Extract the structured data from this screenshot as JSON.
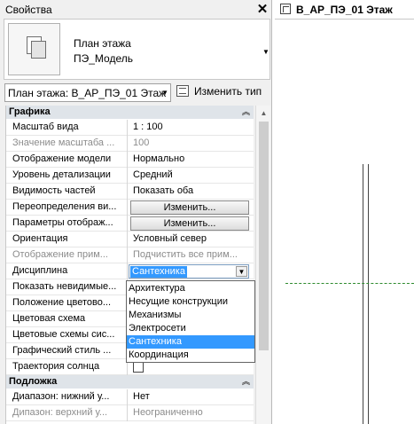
{
  "properties": {
    "title": "Свойства",
    "close_icon": "close-icon",
    "type": {
      "line1": "План этажа",
      "line2": "ПЭ_Модель"
    },
    "view_selector": "План этажа: В_АР_ПЭ_01 Этаж",
    "edit_type": "Изменить тип",
    "sections": {
      "graphics": "Графика",
      "underlay": "Подложка"
    },
    "rows": [
      {
        "name": "Масштаб вида",
        "value": "1 : 100"
      },
      {
        "name": "Значение масштаба ...",
        "value": "100"
      },
      {
        "name": "Отображение модели",
        "value": "Нормально"
      },
      {
        "name": "Уровень детализации",
        "value": "Средний"
      },
      {
        "name": "Видимость частей",
        "value": "Показать оба"
      },
      {
        "name": "Переопределения ви...",
        "value": "Изменить..."
      },
      {
        "name": "Параметры отображ...",
        "value": "Изменить..."
      },
      {
        "name": "Ориентация",
        "value": "Условный север"
      },
      {
        "name": "Отображение прим...",
        "value": "Подчистить все прим..."
      },
      {
        "name": "Дисциплина",
        "value": "Сантехника"
      },
      {
        "name": "Показать невидимые..."
      },
      {
        "name": "Положение цветово..."
      },
      {
        "name": "Цветовая схема"
      },
      {
        "name": "Цветовые схемы сис..."
      },
      {
        "name": "Графический стиль ..."
      },
      {
        "name": "Траектория солнца"
      }
    ],
    "underlay_rows": [
      {
        "name": "Диапазон: нижний у...",
        "value": "Нет"
      },
      {
        "name": "Дипазон: верхний у...",
        "value": "Неограниченно"
      }
    ],
    "discipline_options": [
      "Архитектура",
      "Несущие конструкции",
      "Механизмы",
      "Электросети",
      "Сантехника",
      "Координация"
    ],
    "discipline_selected": "Сантехника"
  },
  "view_tab": {
    "title": "В_АР_ПЭ_01 Этаж",
    "close_icon": "close-icon"
  },
  "colors": {
    "selection": "#3399ff",
    "section_header": "#dfe4e9",
    "grid_line": "#2e8b2e"
  }
}
